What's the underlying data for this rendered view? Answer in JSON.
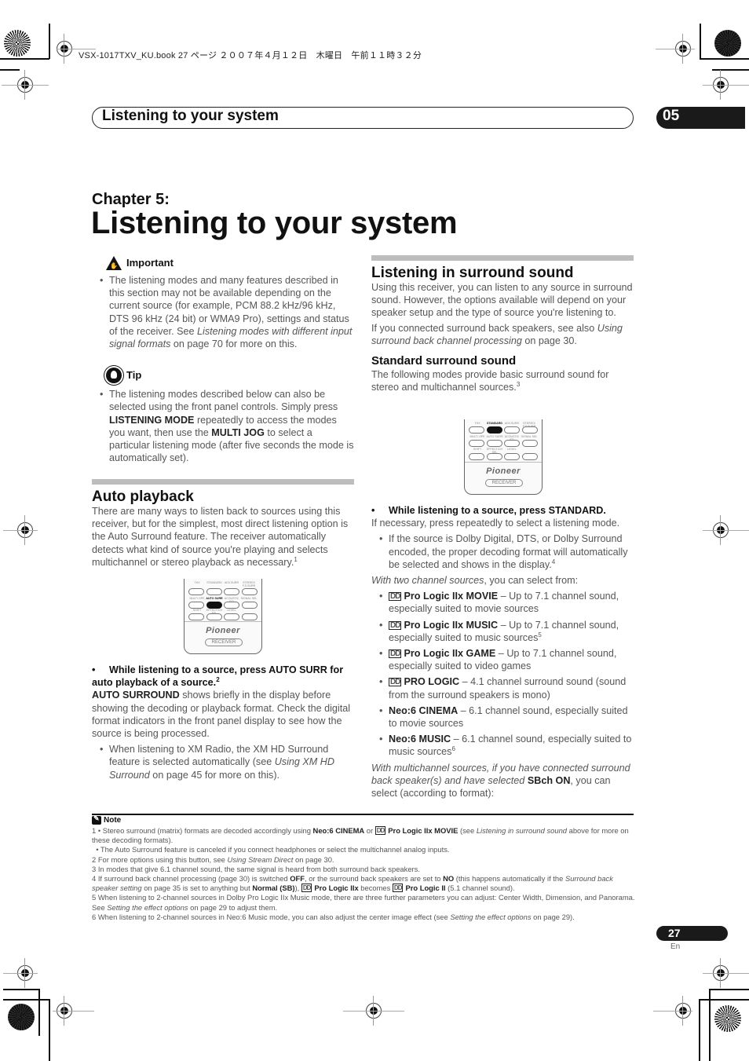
{
  "print_header": {
    "book_line": "VSX-1017TXV_KU.book 27 ページ ２００７年４月１２日　木曜日　午前１１時３２分"
  },
  "running_header": {
    "title": "Listening to your system",
    "chapter_number": "05"
  },
  "chapter": {
    "label": "Chapter 5:",
    "title": "Listening to your system"
  },
  "important": {
    "icon": "warning-hand-icon",
    "heading": "Important",
    "bullet": {
      "text_1": "The listening modes and many features described in this section may not be available depending on the current source (for example, PCM 88.2 kHz/96 kHz, DTS 96 kHz (24 bit) or WMA9 Pro), settings and status of the receiver. See ",
      "link_italic": "Listening modes with different input signal formats",
      "text_2": " on page 70 for more on this."
    }
  },
  "tip": {
    "icon": "lightbulb-gear-icon",
    "heading": "Tip",
    "bullet": {
      "text_1": "The listening modes described below can also be selected using the front panel controls. Simply press ",
      "bold_1": "LISTENING MODE",
      "text_2": " repeatedly to access the modes you want, then use the ",
      "bold_2": "MULTI JOG",
      "text_3": " to select a particular listening mode (after five seconds the mode is automatically set)."
    }
  },
  "auto_playback": {
    "title": "Auto playback",
    "intro": "There are many ways to listen back to sources using this receiver, but for the simplest, most direct listening option is the Auto Surround feature. The receiver automatically detects what kind of source you're playing and selects multichannel or stereo playback as necessary.",
    "intro_footnote": "1",
    "remote": {
      "row1_labels": [
        "THX",
        "STANDARD",
        "ADV.SURR",
        "STEREO/ F.S.SURR"
      ],
      "row2_labels": [
        "MULTI OPE",
        "AUTO SURR",
        "ACOUSTIC EQ",
        "SIGNAL SEL"
      ],
      "row3_labels": [
        "SHIFT",
        "EFFECT/CH SEL",
        "LEVEL",
        ""
      ],
      "highlighted": "AUTO SURR",
      "brand": "Pioneer",
      "receiver_label": "RECEIVER"
    },
    "instruction": "While listening to a source, press AUTO SURR for auto playback of a source.",
    "instruction_footnote": "2",
    "body_bold": "AUTO SURROUND",
    "body": " shows briefly in the display before showing the decoding or playback format. Check the digital format indicators in the front panel display to see how the source is being processed.",
    "sub_bullet": {
      "text_1": "When listening to XM Radio, the XM HD Surround feature is selected automatically (see ",
      "link_italic": "Using XM HD Surround",
      "text_2": " on page 45 for more on this)."
    }
  },
  "surround": {
    "title": "Listening in surround sound",
    "intro": "Using this receiver, you can listen to any source in surround sound. However, the options available will depend on your speaker setup and the type of source you're listening to.",
    "para2_text": "If you connected surround back speakers, see also ",
    "para2_link": "Using surround back channel processing",
    "para2_end": " on page 30.",
    "standard": {
      "title": "Standard surround sound",
      "intro": "The following modes provide basic surround sound for stereo and multichannel sources.",
      "intro_footnote": "3",
      "remote": {
        "row1_labels": [
          "THX",
          "STANDARD",
          "ADV.SURR",
          "STEREO/ F.S.SURR"
        ],
        "row2_labels": [
          "MULTI OPE",
          "AUTO SURR",
          "ACOUSTIC EQ",
          "SIGNAL SEL"
        ],
        "row3_labels": [
          "SHIFT",
          "EFFECT/CH SEL",
          "LEVEL",
          ""
        ],
        "highlighted": "STANDARD",
        "brand": "Pioneer",
        "receiver_label": "RECEIVER"
      },
      "instruction": "While listening to a source, press STANDARD.",
      "after_instruction": "If necessary, press repeatedly to select a listening mode.",
      "sub_bullet": "If the source is Dolby Digital, DTS, or Dolby Surround encoded, the proper decoding format will automatically be selected and shows in the display.",
      "sub_bullet_footnote": "4",
      "two_channel_italic": "With two channel sources",
      "two_channel_rest": ", you can select from:",
      "modes": [
        {
          "dolby": true,
          "name": "Pro Logic IIx MOVIE",
          "desc": " – Up to 7.1 channel sound, especially suited to movie sources",
          "footnote": ""
        },
        {
          "dolby": true,
          "name": "Pro Logic IIx MUSIC",
          "desc": " – Up to 7.1 channel sound, especially suited to music sources",
          "footnote": "5"
        },
        {
          "dolby": true,
          "name": "Pro Logic IIx GAME",
          "desc": " – Up to 7.1 channel sound, especially suited to video games",
          "footnote": ""
        },
        {
          "dolby": true,
          "name": "PRO LOGIC",
          "desc": " – 4.1 channel surround sound (sound from the surround speakers is mono)",
          "footnote": ""
        },
        {
          "dolby": false,
          "name": "Neo:6 CINEMA",
          "desc": " – 6.1 channel sound, especially suited to movie sources",
          "footnote": ""
        },
        {
          "dolby": false,
          "name": "Neo:6 MUSIC",
          "desc": " – 6.1 channel sound, especially suited to music sources",
          "footnote": "6"
        }
      ],
      "multichannel_italic": "With multichannel sources, if you have connected surround back speaker(s) and have selected ",
      "multichannel_bold": "SBch ON",
      "multichannel_rest": ", you can select (according to format):"
    }
  },
  "notes": {
    "heading": "Note",
    "items": [
      {
        "html_parts": [
          "1 • Stereo surround (matrix) formats are decoded accordingly using ",
          {
            "b": "Neo:6 CINEMA"
          },
          " or ",
          {
            "dd": "DD"
          },
          {
            "b": "Pro Logic IIx MOVIE"
          },
          " (see ",
          {
            "i": "Listening in surround sound"
          },
          " above for more on these decoding formats)."
        ]
      },
      {
        "html_parts": [
          "  • The Auto Surround feature is canceled if you connect headphones or select the multichannel analog inputs."
        ]
      },
      {
        "html_parts": [
          "2 For more options using this button, see ",
          {
            "i": "Using Stream Direct"
          },
          " on page 30."
        ]
      },
      {
        "html_parts": [
          "3 In modes that give 6.1 channel sound, the same signal is heard from both surround back speakers."
        ]
      },
      {
        "html_parts": [
          "4 If surround back channel processing (page 30) is switched ",
          {
            "b": "OFF"
          },
          ", or the surround back speakers are set to ",
          {
            "b": "NO"
          },
          " (this happens automatically if the ",
          {
            "i": "Surround back speaker setting"
          },
          " on page 35 is set to anything but ",
          {
            "b": "Normal (SB)"
          },
          "), ",
          {
            "dd": "DD"
          },
          {
            "b": "Pro Logic IIx"
          },
          " becomes ",
          {
            "dd": "DD"
          },
          {
            "b": "Pro Logic II"
          },
          " (5.1 channel sound)."
        ]
      },
      {
        "html_parts": [
          "5 When listening to 2-channel sources in Dolby Pro Logic IIx Music mode, there are three further parameters you can adjust: Center Width, Dimension, and Panorama. See ",
          {
            "i": "Setting the effect options"
          },
          " on page 29 to adjust them."
        ]
      },
      {
        "html_parts": [
          "6 When listening to 2-channel sources in Neo:6 Music mode, you can also adjust the center image effect (see ",
          {
            "i": "Setting the effect options"
          },
          " on page 29)."
        ]
      }
    ]
  },
  "footer": {
    "page_number": "27",
    "language": "En"
  }
}
